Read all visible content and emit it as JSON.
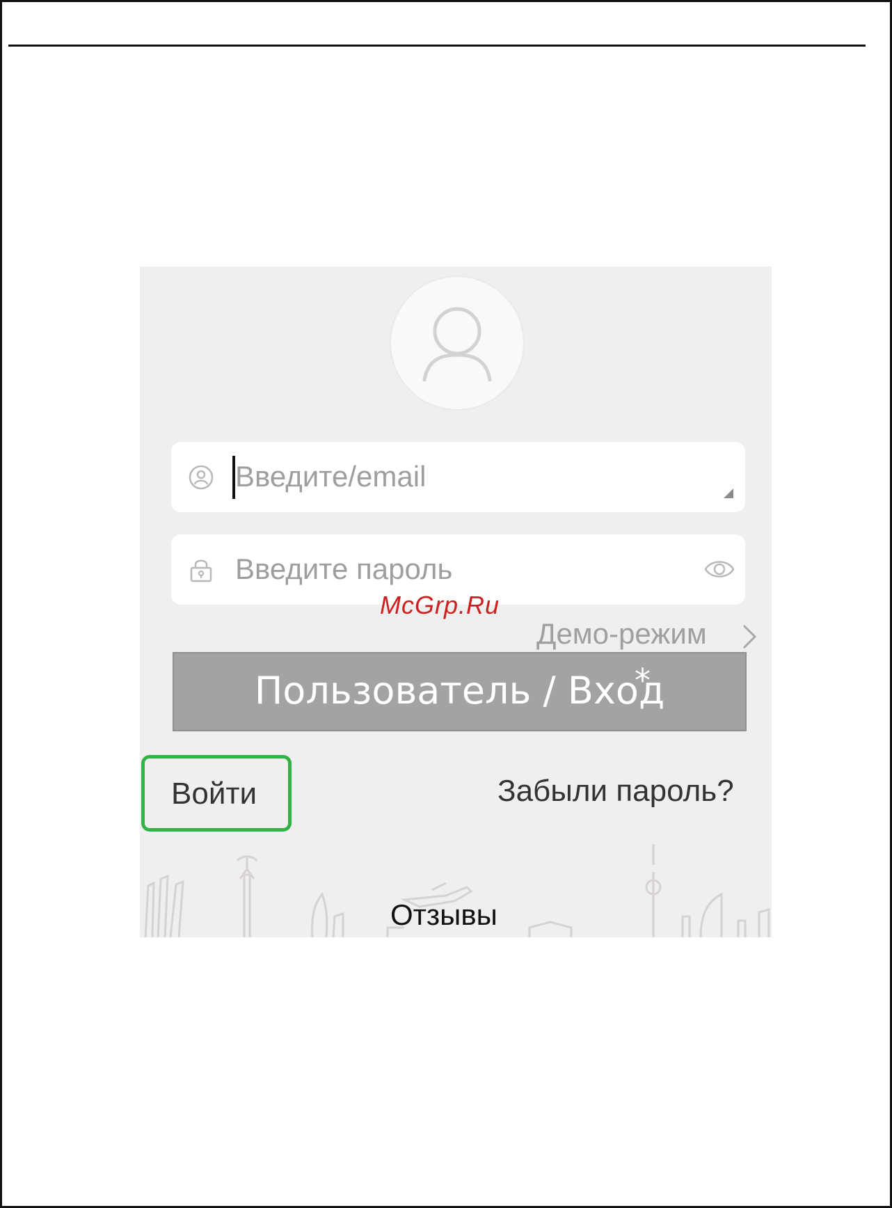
{
  "login": {
    "username_placeholder": "Введите/email",
    "password_placeholder": "Введите пароль",
    "demo_mode": "Демо-режим",
    "banner_label": "Пользователь / Вход",
    "banner_mark": "*",
    "signin_label": "Войти",
    "forgot_password": "Забыли пароль?",
    "reviews": "Отзывы"
  },
  "watermark": "McGrp.Ru",
  "icons": {
    "avatar": "user-avatar-icon",
    "username": "user-circle-icon",
    "password": "lock-icon",
    "show_password": "eye-icon",
    "demo": "chevron-right-icon"
  },
  "colors": {
    "screen_background": "#efefef",
    "banner_background": "#a3a3a3",
    "signin_highlight": "#2fb445",
    "watermark": "#cc1f1f"
  }
}
